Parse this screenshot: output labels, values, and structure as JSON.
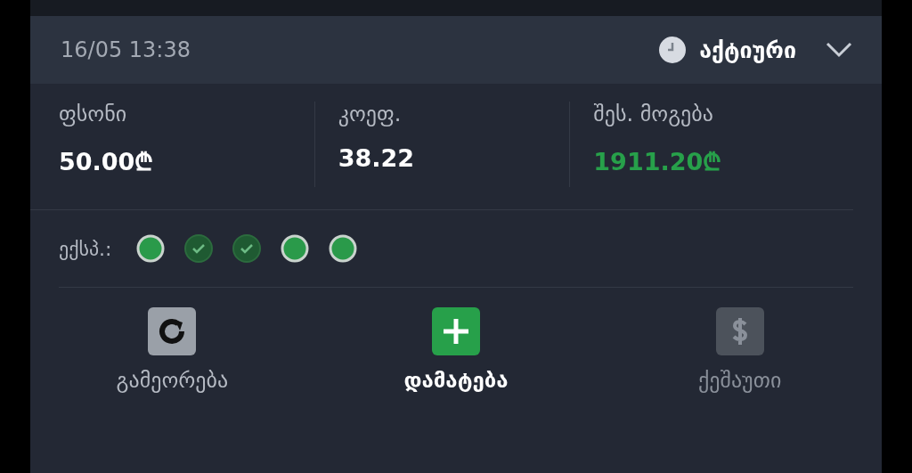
{
  "header": {
    "datetime": "16/05 13:38",
    "status": "აქტიური",
    "expanded": false
  },
  "stats": [
    {
      "label": "ფსონი",
      "value": "50.00₾",
      "highlight": false
    },
    {
      "label": "კოეფ.",
      "value": "38.22",
      "highlight": false
    },
    {
      "label": "შეს. მოგება",
      "value": "1911.20₾",
      "highlight": true
    }
  ],
  "legs": {
    "label": "ექსპ.:",
    "items": [
      {
        "won": false
      },
      {
        "won": true
      },
      {
        "won": true
      },
      {
        "won": false
      },
      {
        "won": false
      }
    ]
  },
  "actions": [
    {
      "kind": "repeat",
      "label": "გამეორება",
      "disabled": false,
      "selected": false
    },
    {
      "kind": "add",
      "label": "დამატება",
      "disabled": false,
      "selected": true
    },
    {
      "kind": "cashout",
      "label": "ქეშაუთი",
      "disabled": true,
      "selected": false
    }
  ]
}
